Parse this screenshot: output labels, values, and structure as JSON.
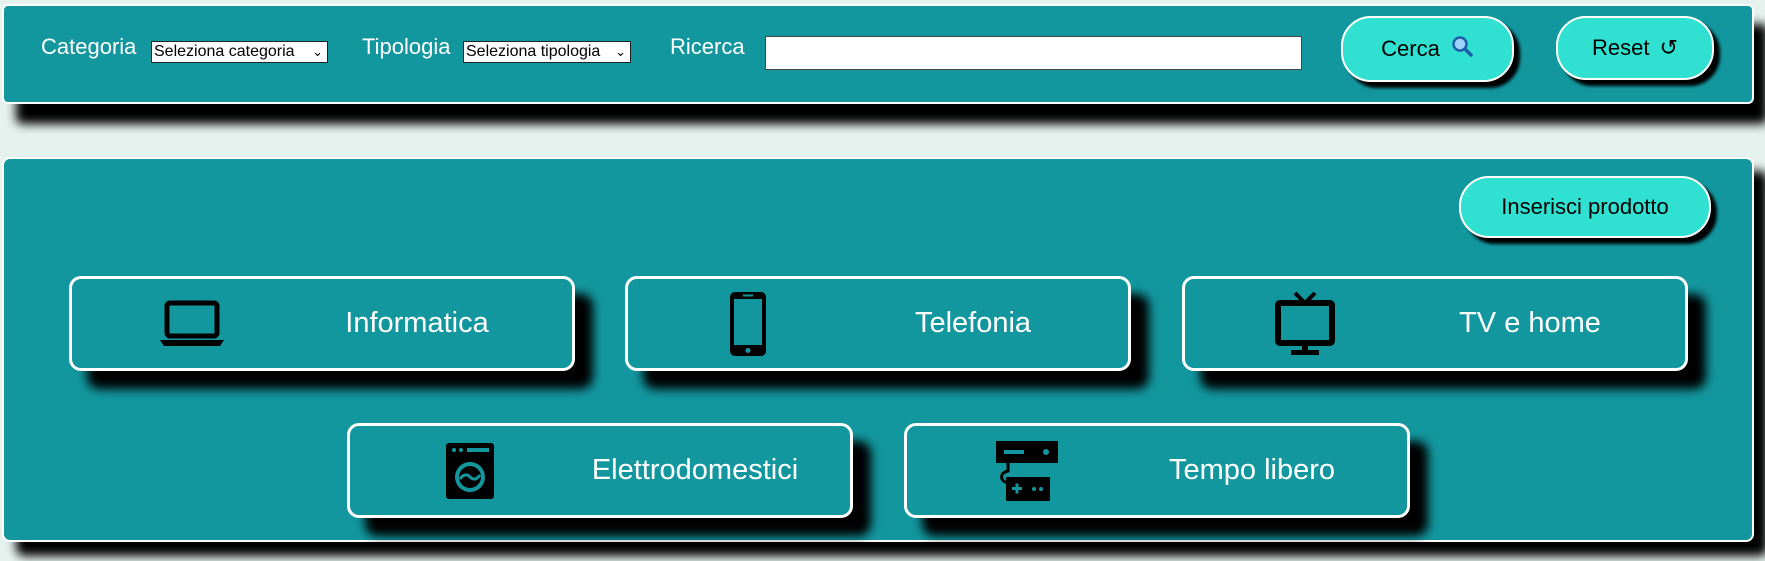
{
  "filters": {
    "categoria_label": "Categoria",
    "categoria_value": "Seleziona categoria",
    "tipologia_label": "Tipologia",
    "tipologia_value": "Seleziona tipologia",
    "ricerca_label": "Ricerca",
    "ricerca_value": "",
    "search_button": "Cerca",
    "search_icon": "magnifier-icon",
    "reset_button": "Reset",
    "reset_icon": "reload-icon"
  },
  "main": {
    "insert_button": "Inserisci prodotto",
    "categories": [
      {
        "label": "Informatica",
        "icon": "laptop-icon"
      },
      {
        "label": "Telefonia",
        "icon": "smartphone-icon"
      },
      {
        "label": "TV e home",
        "icon": "tv-icon"
      },
      {
        "label": "Elettrodomestici",
        "icon": "washing-machine-icon"
      },
      {
        "label": "Tempo libero",
        "icon": "game-console-icon"
      }
    ]
  },
  "colors": {
    "panel": "#13979f",
    "button": "#30e0d0",
    "border": "#ffffff"
  }
}
